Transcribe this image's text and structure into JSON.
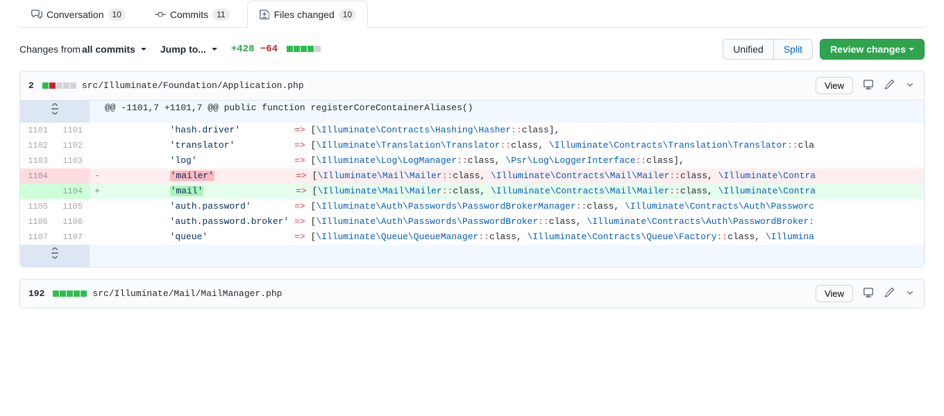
{
  "tabs": {
    "conversation": {
      "label": "Conversation",
      "count": "10"
    },
    "commits": {
      "label": "Commits",
      "count": "11"
    },
    "files": {
      "label": "Files changed",
      "count": "10"
    }
  },
  "toolbar": {
    "changes_prefix": "Changes from ",
    "changes_scope": "all commits",
    "jumpto": "Jump to...",
    "additions": "+428",
    "deletions": "−64",
    "unified": "Unified",
    "split": "Split",
    "review": "Review changes"
  },
  "files": [
    {
      "changed": "2",
      "blocks": [
        "add",
        "del",
        "neutral",
        "neutral",
        "neutral"
      ],
      "path": "src/Illuminate/Foundation/Application.php",
      "view": "View",
      "hunk": "@@ -1101,7 +1101,7 @@ public function registerCoreContainerAliases()",
      "rows": [
        {
          "type": "ctx",
          "old": "1101",
          "new": "1101",
          "key": "hash.driver",
          "arrow": "=>",
          "tokens": [
            [
              "p",
              "["
            ],
            [
              "c",
              "\\Illuminate\\Contracts\\Hashing\\Hasher"
            ],
            [
              "k",
              "::"
            ],
            [
              "p",
              "class"
            ],
            [
              "p",
              "],"
            ]
          ]
        },
        {
          "type": "ctx",
          "old": "1102",
          "new": "1102",
          "key": "translator",
          "arrow": "=>",
          "tokens": [
            [
              "p",
              "["
            ],
            [
              "c",
              "\\Illuminate\\Translation\\Translator"
            ],
            [
              "k",
              "::"
            ],
            [
              "p",
              "class"
            ],
            [
              "p",
              ", "
            ],
            [
              "c",
              "\\Illuminate\\Contracts\\Translation\\Translator"
            ],
            [
              "k",
              "::"
            ],
            [
              "p",
              "cla"
            ]
          ]
        },
        {
          "type": "ctx",
          "old": "1103",
          "new": "1103",
          "key": "log",
          "arrow": "=>",
          "tokens": [
            [
              "p",
              "["
            ],
            [
              "c",
              "\\Illuminate\\Log\\LogManager"
            ],
            [
              "k",
              "::"
            ],
            [
              "p",
              "class"
            ],
            [
              "p",
              ", "
            ],
            [
              "c",
              "\\Psr\\Log\\LoggerInterface"
            ],
            [
              "k",
              "::"
            ],
            [
              "p",
              "class"
            ],
            [
              "p",
              "],"
            ]
          ]
        },
        {
          "type": "del",
          "old": "1104",
          "new": "",
          "key": "mailer",
          "mark": true,
          "arrow": "=>",
          "tokens": [
            [
              "p",
              "["
            ],
            [
              "c",
              "\\Illuminate\\Mail\\Mailer"
            ],
            [
              "k",
              "::"
            ],
            [
              "p",
              "class"
            ],
            [
              "p",
              ", "
            ],
            [
              "c",
              "\\Illuminate\\Contracts\\Mail\\Mailer"
            ],
            [
              "k",
              "::"
            ],
            [
              "p",
              "class"
            ],
            [
              "p",
              ", "
            ],
            [
              "c",
              "\\Illuminate\\Contra"
            ]
          ]
        },
        {
          "type": "add",
          "old": "",
          "new": "1104",
          "key": "mail",
          "mark": true,
          "arrow": "=>",
          "tokens": [
            [
              "p",
              "["
            ],
            [
              "c",
              "\\Illuminate\\Mail\\Mailer"
            ],
            [
              "k",
              "::"
            ],
            [
              "p",
              "class"
            ],
            [
              "p",
              ", "
            ],
            [
              "c",
              "\\Illuminate\\Contracts\\Mail\\Mailer"
            ],
            [
              "k",
              "::"
            ],
            [
              "p",
              "class"
            ],
            [
              "p",
              ", "
            ],
            [
              "c",
              "\\Illuminate\\Contra"
            ]
          ]
        },
        {
          "type": "ctx",
          "old": "1105",
          "new": "1105",
          "key": "auth.password",
          "arrow": "=>",
          "tokens": [
            [
              "p",
              "["
            ],
            [
              "c",
              "\\Illuminate\\Auth\\Passwords\\PasswordBrokerManager"
            ],
            [
              "k",
              "::"
            ],
            [
              "p",
              "class"
            ],
            [
              "p",
              ", "
            ],
            [
              "c",
              "\\Illuminate\\Contracts\\Auth\\Passworc"
            ]
          ]
        },
        {
          "type": "ctx",
          "old": "1106",
          "new": "1106",
          "key": "auth.password.broker",
          "arrow": "=>",
          "tokens": [
            [
              "p",
              "["
            ],
            [
              "c",
              "\\Illuminate\\Auth\\Passwords\\PasswordBroker"
            ],
            [
              "k",
              "::"
            ],
            [
              "p",
              "class"
            ],
            [
              "p",
              ", "
            ],
            [
              "c",
              "\\Illuminate\\Contracts\\Auth\\PasswordBroker:"
            ]
          ]
        },
        {
          "type": "ctx",
          "old": "1107",
          "new": "1107",
          "key": "queue",
          "arrow": "=>",
          "tokens": [
            [
              "p",
              "["
            ],
            [
              "c",
              "\\Illuminate\\Queue\\QueueManager"
            ],
            [
              "k",
              "::"
            ],
            [
              "p",
              "class"
            ],
            [
              "p",
              ", "
            ],
            [
              "c",
              "\\Illuminate\\Contracts\\Queue\\Factory"
            ],
            [
              "k",
              "::"
            ],
            [
              "p",
              "class"
            ],
            [
              "p",
              ", "
            ],
            [
              "c",
              "\\Illumina"
            ]
          ]
        }
      ]
    },
    {
      "changed": "192",
      "blocks": [
        "add",
        "add",
        "add",
        "add",
        "add"
      ],
      "path": "src/Illuminate/Mail/MailManager.php",
      "view": "View"
    }
  ]
}
